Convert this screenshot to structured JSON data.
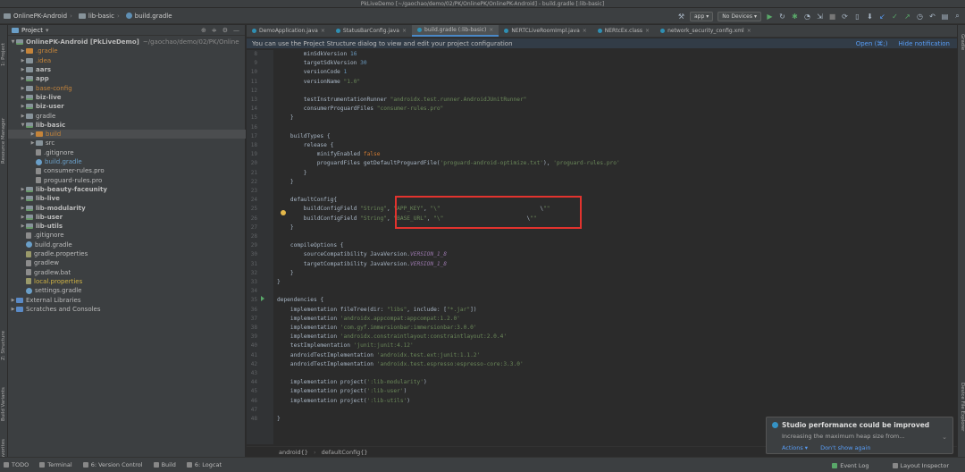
{
  "window": {
    "title": "PkLiveDemo [~/gaochao/demo/02/PK/OnlinePK/OnlinePK-Android] - build.gradle [:lib-basic]"
  },
  "nav": {
    "crumbs": [
      "OnlinePK-Android",
      "lib-basic",
      "build.gradle"
    ],
    "run_config": "app",
    "device": "No Devices"
  },
  "left_tabs": [
    "1: Project",
    "Resource Manager",
    "Z: Structure",
    "Build Variants",
    "2: Favorites"
  ],
  "right_tabs": [
    "Gradle",
    "Device File Explorer"
  ],
  "project_panel": {
    "title": "Project",
    "tree": [
      {
        "label": "OnlinePK-Android [PkLiveDemo]",
        "suffix": "~/gaochao/demo/02/PK/Online",
        "kind": "module",
        "indent": 0,
        "expanded": true,
        "style": "bold"
      },
      {
        "label": ".gradle",
        "kind": "folder-orange",
        "indent": 1,
        "style": "orange"
      },
      {
        "label": ".idea",
        "kind": "folder",
        "indent": 1,
        "style": "orange"
      },
      {
        "label": "aars",
        "kind": "folder",
        "indent": 1,
        "style": "bold"
      },
      {
        "label": "app",
        "kind": "module",
        "indent": 1,
        "style": "bold"
      },
      {
        "label": "base-config",
        "kind": "folder",
        "indent": 1,
        "style": "orange"
      },
      {
        "label": "biz-live",
        "kind": "module",
        "indent": 1,
        "style": "bold"
      },
      {
        "label": "biz-user",
        "kind": "module",
        "indent": 1,
        "style": "bold"
      },
      {
        "label": "gradle",
        "kind": "folder",
        "indent": 1,
        "style": "normal"
      },
      {
        "label": "lib-basic",
        "kind": "module",
        "indent": 1,
        "expanded": true,
        "style": "bold"
      },
      {
        "label": "build",
        "kind": "folder-orange",
        "indent": 2,
        "style": "orange",
        "selected": true
      },
      {
        "label": "src",
        "kind": "folder",
        "indent": 2,
        "style": "normal"
      },
      {
        "label": ".gitignore",
        "kind": "file",
        "indent": 2,
        "style": "normal"
      },
      {
        "label": "build.gradle",
        "kind": "gradle",
        "indent": 2,
        "style": "blue"
      },
      {
        "label": "consumer-rules.pro",
        "kind": "file",
        "indent": 2,
        "style": "normal"
      },
      {
        "label": "proguard-rules.pro",
        "kind": "file",
        "indent": 2,
        "style": "normal"
      },
      {
        "label": "lib-beauty-faceunity",
        "kind": "module",
        "indent": 1,
        "style": "bold"
      },
      {
        "label": "lib-live",
        "kind": "module",
        "indent": 1,
        "style": "bold"
      },
      {
        "label": "lib-modularity",
        "kind": "module",
        "indent": 1,
        "style": "bold"
      },
      {
        "label": "lib-user",
        "kind": "module",
        "indent": 1,
        "style": "bold"
      },
      {
        "label": "lib-utils",
        "kind": "module",
        "indent": 1,
        "style": "bold"
      },
      {
        "label": ".gitignore",
        "kind": "file",
        "indent": 1,
        "style": "normal"
      },
      {
        "label": "build.gradle",
        "kind": "gradle",
        "indent": 1,
        "style": "normal"
      },
      {
        "label": "gradle.properties",
        "kind": "props",
        "indent": 1,
        "style": "normal"
      },
      {
        "label": "gradlew",
        "kind": "file",
        "indent": 1,
        "style": "normal"
      },
      {
        "label": "gradlew.bat",
        "kind": "file",
        "indent": 1,
        "style": "normal"
      },
      {
        "label": "local.properties",
        "kind": "props",
        "indent": 1,
        "style": "yellow"
      },
      {
        "label": "settings.gradle",
        "kind": "gradle",
        "indent": 1,
        "style": "normal"
      },
      {
        "label": "External Libraries",
        "kind": "lib",
        "indent": 0,
        "style": "normal"
      },
      {
        "label": "Scratches and Consoles",
        "kind": "lib",
        "indent": 0,
        "style": "normal"
      }
    ]
  },
  "tabs": [
    {
      "label": "DemoApplication.java",
      "active": false
    },
    {
      "label": "StatusBarConfig.java",
      "active": false
    },
    {
      "label": "build.gradle (:lib-basic)",
      "active": true
    },
    {
      "label": "NERTCLiveRoomImpl.java",
      "active": false
    },
    {
      "label": "NERtcEx.class",
      "active": false
    },
    {
      "label": "network_security_config.xml",
      "active": false
    }
  ],
  "banner": {
    "message": "You can use the Project Structure dialog to view and edit your project configuration",
    "open_link": "Open (⌘;)",
    "hide_link": "Hide notification"
  },
  "code": {
    "lines": [
      {
        "n": "8",
        "text": "        minSdkVersion 16"
      },
      {
        "n": "9",
        "text": "        targetSdkVersion 30"
      },
      {
        "n": "10",
        "text": "        versionCode 1"
      },
      {
        "n": "11",
        "text": "        versionName \"1.0\""
      },
      {
        "n": "12",
        "text": ""
      },
      {
        "n": "13",
        "text": "        testInstrumentationRunner \"androidx.test.runner.AndroidJUnitRunner\""
      },
      {
        "n": "14",
        "text": "        consumerProguardFiles \"consumer-rules.pro\""
      },
      {
        "n": "15",
        "text": "    }"
      },
      {
        "n": "16",
        "text": ""
      },
      {
        "n": "17",
        "text": "    buildTypes {"
      },
      {
        "n": "18",
        "text": "        release {"
      },
      {
        "n": "19",
        "text": "            minifyEnabled false"
      },
      {
        "n": "20",
        "text": "            proguardFiles getDefaultProguardFile('proguard-android-optimize.txt'), 'proguard-rules.pro'"
      },
      {
        "n": "21",
        "text": "        }"
      },
      {
        "n": "22",
        "text": "    }"
      },
      {
        "n": "23",
        "text": ""
      },
      {
        "n": "24",
        "text": "    defaultConfig{"
      },
      {
        "n": "25",
        "text": "        buildConfigField \"String\", \"APP_KEY\", \"\\\"                              \\\"\""
      },
      {
        "n": "26",
        "text": "        buildConfigField \"String\", \"BASE_URL\", \"\\\"                         \\\"\""
      },
      {
        "n": "27",
        "text": "    }"
      },
      {
        "n": "28",
        "text": ""
      },
      {
        "n": "29",
        "text": "    compileOptions {"
      },
      {
        "n": "30",
        "text": "        sourceCompatibility JavaVersion.VERSION_1_8"
      },
      {
        "n": "31",
        "text": "        targetCompatibility JavaVersion.VERSION_1_8"
      },
      {
        "n": "32",
        "text": "    }"
      },
      {
        "n": "33",
        "text": "}"
      },
      {
        "n": "34",
        "text": ""
      },
      {
        "n": "35",
        "text": "dependencies {"
      },
      {
        "n": "36",
        "text": "    implementation fileTree(dir: \"libs\", include: [\"*.jar\"])"
      },
      {
        "n": "37",
        "text": "    implementation 'androidx.appcompat:appcompat:1.2.0'"
      },
      {
        "n": "38",
        "text": "    implementation 'com.gyf.immersionbar:immersionbar:3.0.0'"
      },
      {
        "n": "39",
        "text": "    implementation 'androidx.constraintlayout:constraintlayout:2.0.4'"
      },
      {
        "n": "40",
        "text": "    testImplementation 'junit:junit:4.12'"
      },
      {
        "n": "41",
        "text": "    androidTestImplementation 'androidx.test.ext:junit:1.1.2'"
      },
      {
        "n": "42",
        "text": "    androidTestImplementation 'androidx.test.espresso:espresso-core:3.3.0'"
      },
      {
        "n": "43",
        "text": ""
      },
      {
        "n": "44",
        "text": "    implementation project(':lib-modularity')"
      },
      {
        "n": "45",
        "text": "    implementation project(':lib-user')"
      },
      {
        "n": "46",
        "text": "    implementation project(':lib-utils')"
      },
      {
        "n": "47",
        "text": ""
      },
      {
        "n": "48",
        "text": "}"
      }
    ]
  },
  "editor_breadcrumb": [
    "android{}",
    "defaultConfig{}"
  ],
  "status_left": [
    "TODO",
    "Terminal",
    "6: Version Control",
    "Build",
    "6: Logcat"
  ],
  "status_right": [
    "Event Log",
    "Layout Inspector"
  ],
  "popup": {
    "title": "Studio performance could be improved",
    "body": "Increasing the maximum heap size from...",
    "actions": [
      "Actions ▾",
      "Don't show again"
    ]
  },
  "colors": {
    "accent": "#4a88c7",
    "highlight_box": "#e2332e",
    "background": "#2b2b2b",
    "panel": "#3c3f41"
  }
}
